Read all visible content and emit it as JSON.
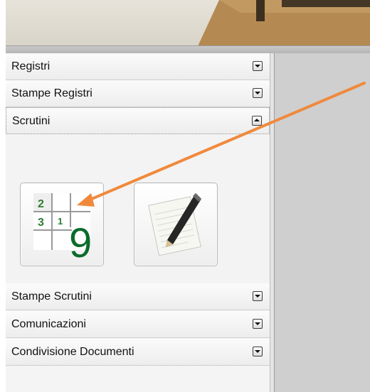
{
  "sidebar": {
    "sections": [
      {
        "label": "Registri",
        "state": "collapsed"
      },
      {
        "label": "Stampe Registri",
        "state": "collapsed"
      },
      {
        "label": "Scrutini",
        "state": "expanded"
      },
      {
        "label": "Stampe Scrutini",
        "state": "collapsed"
      },
      {
        "label": "Comunicazioni",
        "state": "collapsed"
      },
      {
        "label": "Condivisione Documenti",
        "state": "collapsed"
      }
    ],
    "scrutini_tiles": [
      {
        "icon": "grid-numbers-icon",
        "digits": {
          "top_left": "2",
          "mid_left": "3",
          "mid_center": "1",
          "big": "9"
        }
      },
      {
        "icon": "notepad-pencil-icon"
      }
    ]
  },
  "colors": {
    "annotation_arrow": "#f0893c",
    "grid_digits": "#2e7d32",
    "big_digit": "#0b6b2b"
  }
}
